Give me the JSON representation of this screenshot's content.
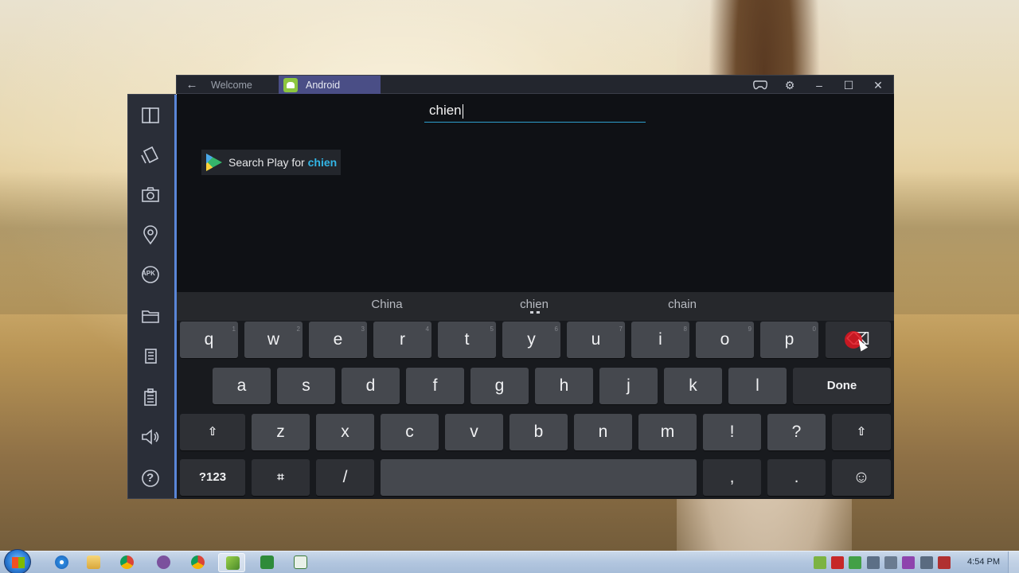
{
  "window": {
    "back_icon": "arrow-left-icon",
    "tabs": [
      {
        "label": "Welcome"
      },
      {
        "label": "Android"
      }
    ],
    "controls": [
      "gamepad-icon",
      "gear-icon",
      "minimize-icon",
      "maximize-icon",
      "close-icon"
    ]
  },
  "sidebar": {
    "items": [
      "multi-window-icon",
      "rotate-icon",
      "camera-icon",
      "location-pin-icon",
      "apk-icon",
      "folder-icon",
      "copy-icon",
      "paste-icon",
      "volume-icon",
      "help-icon"
    ],
    "apk_label": "APK",
    "help_label": "?"
  },
  "search": {
    "value": "chien"
  },
  "play_suggestion": {
    "prefix": "Search Play for ",
    "query": "chien"
  },
  "keyboard": {
    "suggestions": [
      "China",
      "chien",
      "chain"
    ],
    "row1": [
      {
        "k": "q",
        "h": "1"
      },
      {
        "k": "w",
        "h": "2"
      },
      {
        "k": "e",
        "h": "3"
      },
      {
        "k": "r",
        "h": "4"
      },
      {
        "k": "t",
        "h": "5"
      },
      {
        "k": "y",
        "h": "6"
      },
      {
        "k": "u",
        "h": "7"
      },
      {
        "k": "i",
        "h": "8"
      },
      {
        "k": "o",
        "h": "9"
      },
      {
        "k": "p",
        "h": "0"
      }
    ],
    "row2": [
      "a",
      "s",
      "d",
      "f",
      "g",
      "h",
      "j",
      "k",
      "l"
    ],
    "done_label": "Done",
    "row3": [
      "z",
      "x",
      "c",
      "v",
      "b",
      "n",
      "m",
      "!",
      "?"
    ],
    "shift_icon": "⇧",
    "symbols_label": "?123",
    "settings_icon": "⌗",
    "slash_label": "/",
    "comma_label": ",",
    "period_label": ".",
    "emoji_icon": "☺",
    "backspace_icon": "⌫"
  },
  "taskbar": {
    "clock": "4:54 PM"
  },
  "colors": {
    "accent": "#33b5e5",
    "window_tab_active": "#4a4e86",
    "sidebar_accent": "#5a86d8"
  }
}
